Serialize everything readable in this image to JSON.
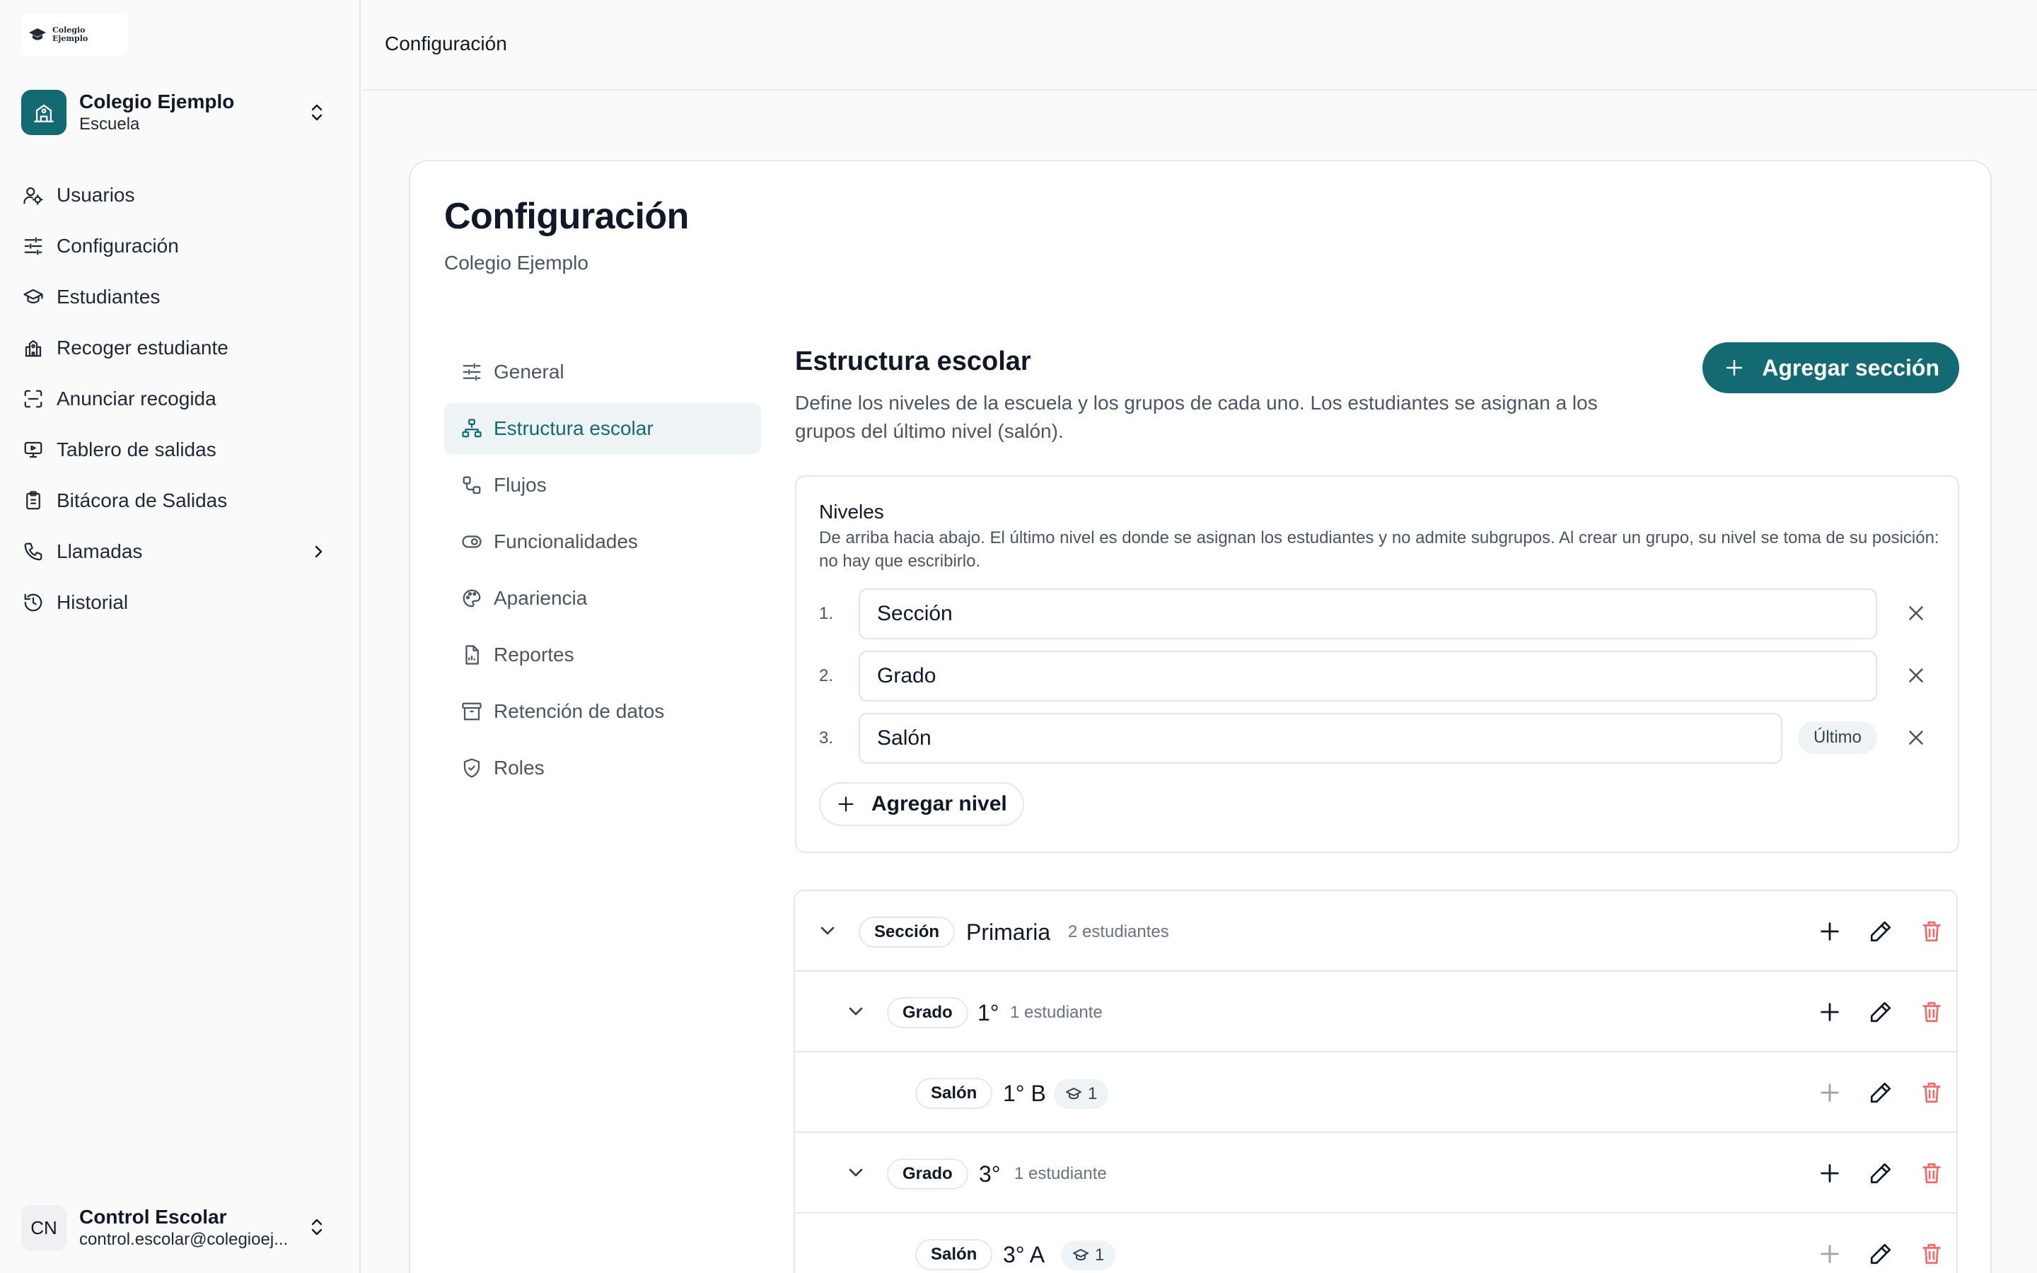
{
  "brand": {
    "logo_text_line1": "Colegio",
    "logo_text_line2": "Ejemplo"
  },
  "org": {
    "name": "Colegio Ejemplo",
    "type": "Escuela"
  },
  "sidebar": {
    "items": [
      {
        "label": "Usuarios",
        "icon": "users-icon"
      },
      {
        "label": "Configuración",
        "icon": "sliders-icon"
      },
      {
        "label": "Estudiantes",
        "icon": "graduation-cap-icon"
      },
      {
        "label": "Recoger estudiante",
        "icon": "school-building-icon"
      },
      {
        "label": "Anunciar recogida",
        "icon": "scan-icon"
      },
      {
        "label": "Tablero de salidas",
        "icon": "monitor-icon"
      },
      {
        "label": "Bitácora de Salidas",
        "icon": "clipboard-icon"
      },
      {
        "label": "Llamadas",
        "icon": "phone-icon"
      },
      {
        "label": "Historial",
        "icon": "history-icon"
      }
    ]
  },
  "user": {
    "initials": "CN",
    "name": "Control Escolar",
    "email": "control.escolar@colegioej..."
  },
  "topbar": {
    "breadcrumb": "Configuración"
  },
  "page": {
    "title": "Configuración",
    "subtitle": "Colegio Ejemplo"
  },
  "settings_nav": {
    "items": [
      {
        "label": "General",
        "icon": "sliders-icon"
      },
      {
        "label": "Estructura escolar",
        "icon": "hierarchy-icon"
      },
      {
        "label": "Flujos",
        "icon": "workflow-icon"
      },
      {
        "label": "Funcionalidades",
        "icon": "toggle-icon"
      },
      {
        "label": "Apariencia",
        "icon": "palette-icon"
      },
      {
        "label": "Reportes",
        "icon": "file-chart-icon"
      },
      {
        "label": "Retención de datos",
        "icon": "archive-icon"
      },
      {
        "label": "Roles",
        "icon": "shield-check-icon"
      }
    ]
  },
  "structure": {
    "title": "Estructura escolar",
    "description": "Define los niveles de la escuela y los grupos de cada uno. Los estudiantes se asignan a los grupos del último nivel (salón).",
    "add_section_label": "Agregar sección",
    "levels": {
      "title": "Niveles",
      "description": "De arriba hacia abajo. El último nivel es donde se asignan los estudiantes y no admite subgrupos. Al crear un grupo, su nivel se toma de su posición: no hay que escribirlo.",
      "rows": [
        {
          "number": "1.",
          "value": "Sección"
        },
        {
          "number": "2.",
          "value": "Grado"
        },
        {
          "number": "3.",
          "value": "Salón",
          "badge": "Último"
        }
      ],
      "add_level_label": "Agregar nivel"
    },
    "tree": {
      "rows": [
        {
          "tag": "Sección",
          "name": "Primaria",
          "count": "2 estudiantes"
        },
        {
          "tag": "Grado",
          "name": "1°",
          "count": "1 estudiante"
        },
        {
          "tag": "Salón",
          "name": "1° B",
          "students": "1"
        },
        {
          "tag": "Grado",
          "name": "3°",
          "count": "1 estudiante"
        },
        {
          "tag": "Salón",
          "name": "3° A",
          "students": "1"
        }
      ]
    }
  },
  "colors": {
    "accent": "#136a72",
    "danger": "#ef6b6b",
    "active_bg": "#eef3f5"
  }
}
